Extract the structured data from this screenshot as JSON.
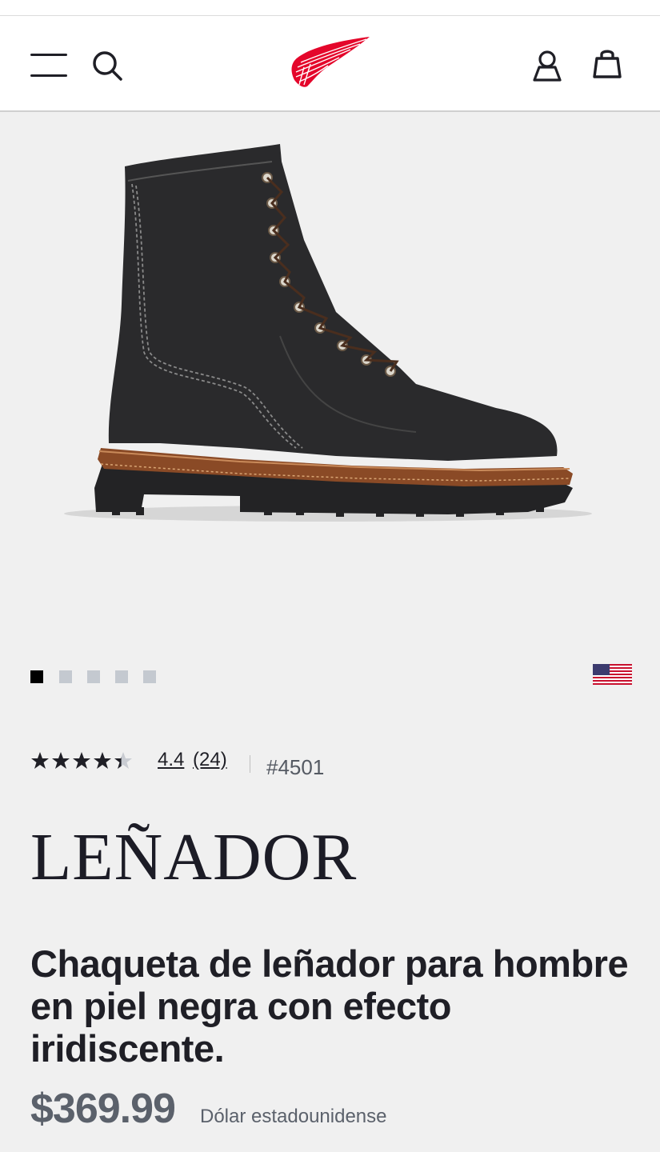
{
  "header": {
    "menu_icon": "menu-icon",
    "search_icon": "search-icon",
    "logo_icon": "red-wing-logo",
    "account_icon": "account-icon",
    "bag_icon": "shopping-bag-icon"
  },
  "gallery": {
    "image": "black leather lace-up work boot",
    "slide_count": 5,
    "active_slide": 1,
    "origin_flag": "us-flag-icon"
  },
  "product": {
    "rating": "4.4",
    "rating_value": 4.4,
    "review_count": "(24)",
    "sku": "#4501",
    "brand_title": "LEÑADOR",
    "name": "Chaqueta de leñador para hombre en piel negra con efecto iridiscente.",
    "price": "$369.99",
    "currency": "Dólar estadounidense"
  },
  "colors": {
    "brand_red": "#e4062b",
    "text_dark": "#1f1f26",
    "price_gray": "#5b616b",
    "background": "#f0f0f0"
  }
}
